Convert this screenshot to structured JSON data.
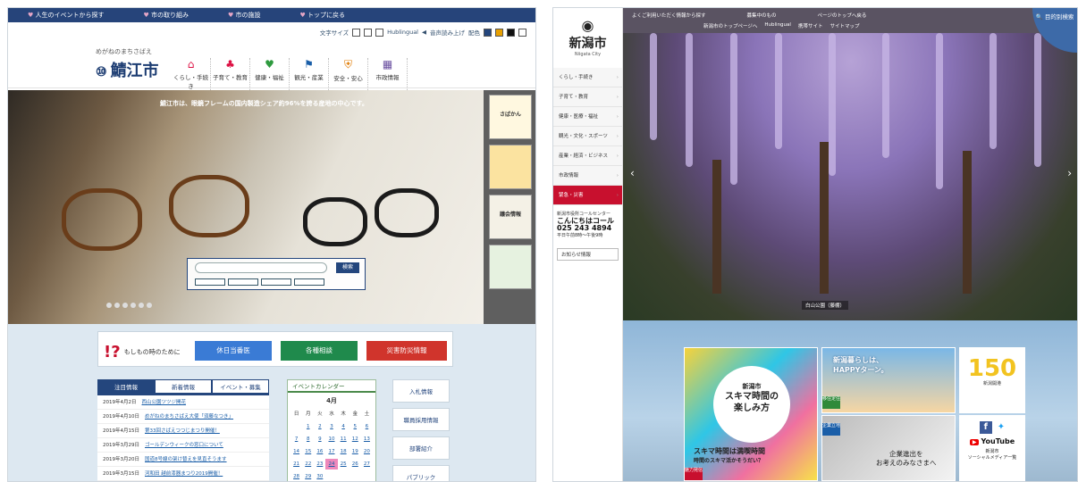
{
  "left": {
    "topbar": [
      "人生のイベントから探す",
      "市の取り組み",
      "市の施設",
      "トップに戻る"
    ],
    "tools": {
      "size": "文字サイズ",
      "pron": "Hublingual",
      "read": "音声読み上げ",
      "color": "配色"
    },
    "logo_small": "めがねのまちさばえ",
    "logo": "鯖江市",
    "nav": [
      {
        "icon": "house-icon",
        "glyph": "⌂",
        "label": "くらし・手続き"
      },
      {
        "icon": "child-icon",
        "glyph": "♣",
        "label": "子育て・教育"
      },
      {
        "icon": "heart-icon",
        "glyph": "♥",
        "label": "健康・福祉"
      },
      {
        "icon": "flag-icon",
        "glyph": "⚑",
        "label": "観光・産業"
      },
      {
        "icon": "shield-icon",
        "glyph": "⛨",
        "label": "安全・安心"
      },
      {
        "icon": "building-icon",
        "glyph": "▦",
        "label": "市政情報"
      }
    ],
    "hero_caption": "鯖江市は、眼鏡フレームの国内製造シェア約96%を誇る産地の中心です。",
    "search_button": "検索",
    "side_banners": [
      "さばかん",
      "",
      "",
      "議会情報",
      ""
    ],
    "emergency_title": "もしもの時のために",
    "emergency_buttons": [
      {
        "label": "休日当番医",
        "color": "#3a7bd5"
      },
      {
        "label": "各種相談",
        "color": "#1f8a4c"
      },
      {
        "label": "災害防災情報",
        "color": "#d0342c"
      }
    ],
    "tabs": [
      "注目情報",
      "新着情報",
      "イベント・募集"
    ],
    "news": [
      {
        "date": "2019年4月2日",
        "text": "西山公園ツツジ開花"
      },
      {
        "date": "2019年4月10日",
        "text": "めがねのまちさばえ大使「須藤なつき」"
      },
      {
        "date": "2019年4月15日",
        "text": "第33回さばえつつじまつり開催！"
      },
      {
        "date": "2019年3月29日",
        "text": "ゴールデンウィークの窓口について"
      },
      {
        "date": "2019年3月20日",
        "text": "国道8号線の架け替えを見直そうます"
      },
      {
        "date": "2019年3月15日",
        "text": "河和田 越前漆器まつり2019開催！"
      }
    ],
    "calendar": {
      "title": "イベントカレンダー",
      "month": "4月",
      "head": [
        "日",
        "月",
        "火",
        "水",
        "木",
        "金",
        "土"
      ],
      "days": [
        "",
        "1",
        "2",
        "3",
        "4",
        "5",
        "6",
        "7",
        "8",
        "9",
        "10",
        "11",
        "12",
        "13",
        "14",
        "15",
        "16",
        "17",
        "18",
        "19",
        "20",
        "21",
        "22",
        "23",
        "24",
        "25",
        "26",
        "27",
        "28",
        "29",
        "30",
        "",
        "",
        ""
      ],
      "today": "24"
    },
    "right_links": [
      "入札情報",
      "職員採用情報",
      "部署紹介",
      "パブリック"
    ]
  },
  "right": {
    "logo": "新潟市",
    "logo_en": "Niigata City",
    "toplinks": [
      "よくご利用いただく情報から探す",
      "募集中のもの",
      "ページのトップへ戻る"
    ],
    "toplinks2": [
      "新潟市のトップページへ",
      "Hublingual",
      "携帯サイト",
      "サイトマップ"
    ],
    "search": "目的別検索",
    "nav": [
      "くらし・手続き",
      "子育て・教育",
      "健康・医療・福祉",
      "観光・文化・スポーツ",
      "産業・経済・ビジネス",
      "市政情報"
    ],
    "emergency": "緊急・災害",
    "callcenter": {
      "title": "新潟市役所コールセンター",
      "name": "こんにちはコール",
      "tel": "025 243 4894",
      "hours": "平日午前8時〜午後9時"
    },
    "oshirase": "お知らせ情報",
    "hero_caption": "白山公園（藤棚）",
    "tile1": {
      "top": "新潟市",
      "main": "スキマ時間の\n楽しみ方",
      "cap": "スキマ時間は満喫時間",
      "sub": "時間のスキマ活かそうだい？",
      "tag": "魅力発信"
    },
    "tile2": {
      "title": "新潟暮らしは、\nHAPPYターン。",
      "tag": "移住定住"
    },
    "tile3": {
      "title": "企業進出を\nお考えのみなさまへ",
      "tag": "企業立地"
    },
    "tile4": {
      "num": "150",
      "sub": "新潟開港"
    },
    "tile5": {
      "youtube": "YouTube",
      "label": "新潟市\nソーシャルメディア一覧"
    }
  }
}
